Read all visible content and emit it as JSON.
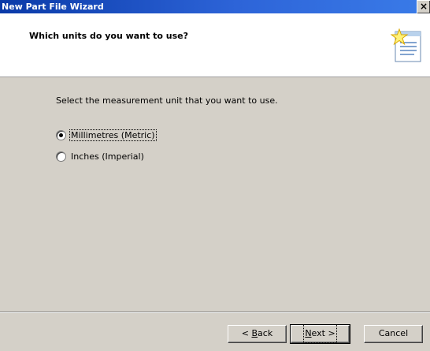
{
  "window": {
    "title": "New Part File Wizard",
    "close_label": "×"
  },
  "header": {
    "title": "Which units do you want to use?",
    "icon": "wizard-star-document-icon"
  },
  "body": {
    "instruction": "Select the measurement unit that you want to use.",
    "options": [
      {
        "label": "Millimetres (Metric)",
        "selected": true
      },
      {
        "label": "Inches (Imperial)",
        "selected": false
      }
    ]
  },
  "buttons": {
    "back_pre": "< ",
    "back_accel": "B",
    "back_post": "ack",
    "next_accel": "N",
    "next_post": "ext >",
    "cancel": "Cancel"
  }
}
